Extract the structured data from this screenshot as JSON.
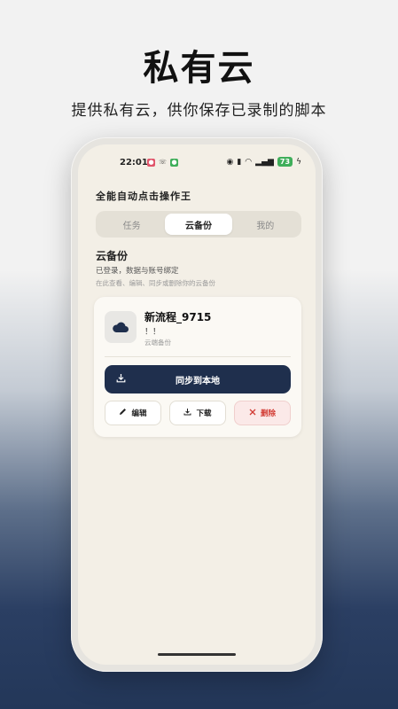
{
  "promo": {
    "headline": "私有云",
    "subline": "提供私有云，供你保存已录制的脚本"
  },
  "statusbar": {
    "time": "22:01",
    "battery": "73"
  },
  "app": {
    "name": "全能自动点击操作王"
  },
  "tabs": [
    {
      "label": "任务",
      "active": false
    },
    {
      "label": "云备份",
      "active": true
    },
    {
      "label": "我的",
      "active": false
    }
  ],
  "section": {
    "title": "云备份",
    "status": "已登录，数据与账号绑定",
    "hint": "在此查看、编辑、同步或删除你的云备份"
  },
  "backup_item": {
    "name": "新流程_9715",
    "desc": "！！",
    "tag": "云端备份"
  },
  "actions": {
    "sync": "同步到本地",
    "edit": "编辑",
    "download": "下载",
    "delete": "删除"
  },
  "colors": {
    "primary": "#1f2f4d",
    "danger": "#d23b33",
    "battery": "#3fae5a"
  },
  "icons": {
    "cloud": "cloud-icon",
    "download": "download-icon",
    "edit": "pencil-icon",
    "delete": "close-icon"
  }
}
